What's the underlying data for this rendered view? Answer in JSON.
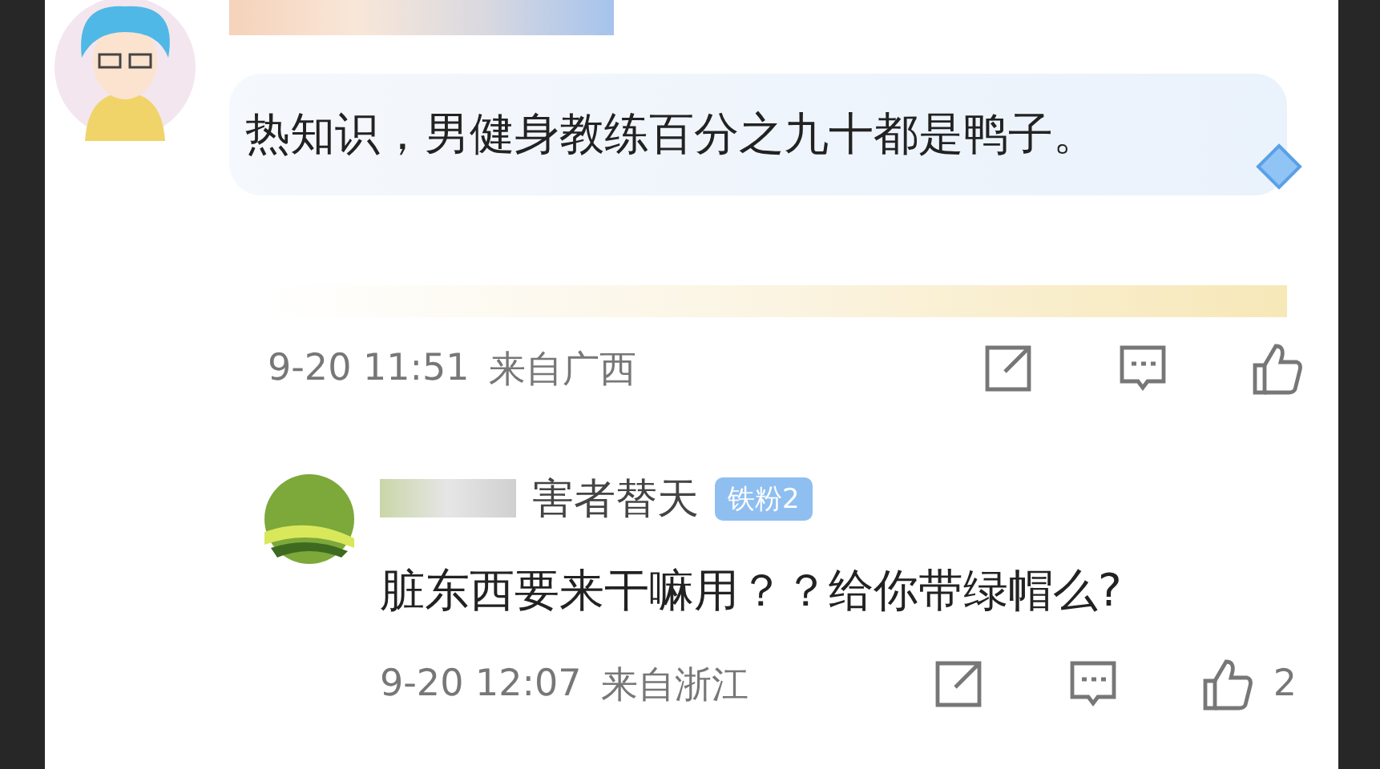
{
  "top_comment": {
    "text": "热知识，男健身教练百分之九十都是鸭子。"
  },
  "top_meta": {
    "time": "9-20 11:51",
    "location": "来自广西"
  },
  "reply": {
    "name": "害者替天",
    "badge": "铁粉2",
    "text": "脏东西要来干嘛用？？给你带绿帽么?",
    "time": "9-20 12:07",
    "location": "来自浙江",
    "likes": "2"
  }
}
